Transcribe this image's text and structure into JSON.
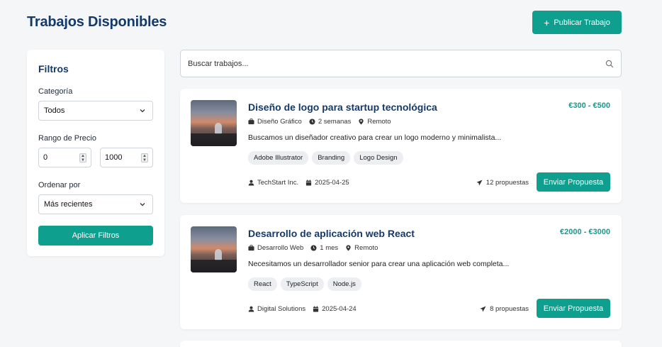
{
  "header": {
    "title": "Trabajos Disponibles",
    "publish_label": "Publicar Trabajo"
  },
  "filters": {
    "title": "Filtros",
    "category_label": "Categoría",
    "category_value": "Todos",
    "price_label": "Rango de Precio",
    "price_min": "0",
    "price_max": "1000",
    "sort_label": "Ordenar por",
    "sort_value": "Más recientes",
    "apply_label": "Aplicar Filtros"
  },
  "search": {
    "placeholder": "Buscar trabajos..."
  },
  "jobs": [
    {
      "title": "Diseño de logo para startup tecnológica",
      "price": "€300 - €500",
      "category": "Diseño Gráfico",
      "duration": "2 semanas",
      "location": "Remoto",
      "description": "Buscamos un diseñador creativo para crear un logo moderno y minimalista...",
      "tags": [
        "Adobe Illustrator",
        "Branding",
        "Logo Design"
      ],
      "company": "TechStart Inc.",
      "date": "2025-04-25",
      "proposals": "12 propuestas",
      "action_label": "Enviar Propuesta"
    },
    {
      "title": "Desarrollo de aplicación web React",
      "price": "€2000 - €3000",
      "category": "Desarrollo Web",
      "duration": "1 mes",
      "location": "Remoto",
      "description": "Necesitamos un desarrollador senior para crear una aplicación web completa...",
      "tags": [
        "React",
        "TypeScript",
        "Node.js"
      ],
      "company": "Digital Solutions",
      "date": "2025-04-24",
      "proposals": "8 propuestas",
      "action_label": "Enviar Propuesta"
    }
  ],
  "colors": {
    "accent": "#0e9f8e",
    "heading": "#143a6b",
    "background": "#f5f6f8"
  }
}
